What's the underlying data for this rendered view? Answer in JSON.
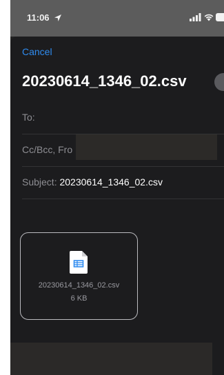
{
  "status_bar": {
    "time": "11:06",
    "icons": [
      "location-arrow-icon",
      "signal-icon",
      "wifi-icon",
      "battery-icon"
    ]
  },
  "compose": {
    "cancel_label": "Cancel",
    "title": "20230614_1346_02.csv",
    "to_label": "To:",
    "cc_label": "Cc/Bcc, Fro",
    "subject_label": "Subject:",
    "subject_value": "20230614_1346_02.csv"
  },
  "attachment": {
    "icon": "spreadsheet-file-icon",
    "filename": "20230614_1346_02.csv",
    "size": "6 KB"
  },
  "colors": {
    "accent": "#2f8cf0",
    "sheet_background": "#1c1c1e",
    "status_background": "#5c5c5c"
  }
}
